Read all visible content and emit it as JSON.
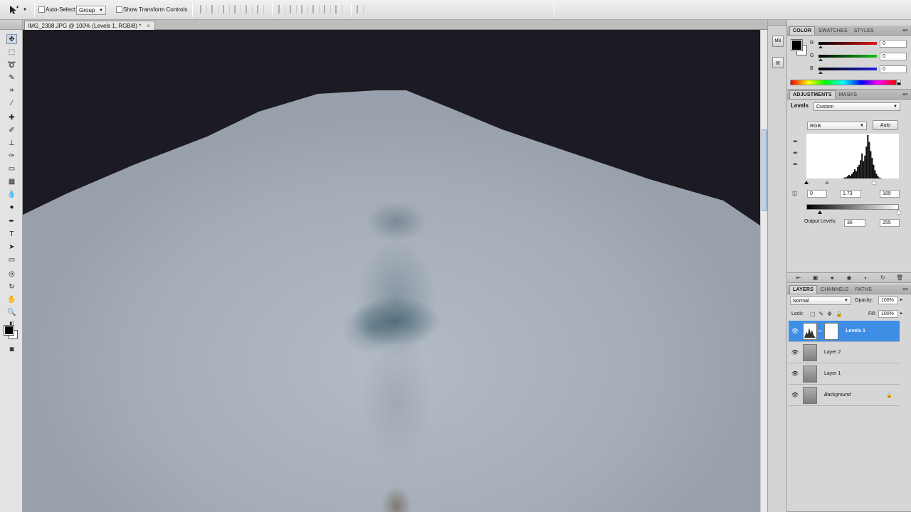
{
  "options_bar": {
    "auto_select_label": "Auto-Select:",
    "auto_select_value": "Group",
    "transform_label": "Show Transform Controls"
  },
  "document": {
    "tab_title": "IMG_2308.JPG @ 100% (Levels 1, RGB/8) *",
    "close_glyph": "×"
  },
  "panels": {
    "color": {
      "tabs": [
        "COLOR",
        "SWATCHES",
        "STYLES"
      ],
      "channels": [
        {
          "label": "R",
          "value": "0",
          "color": "#e01818"
        },
        {
          "label": "G",
          "value": "0",
          "color": "#18c018"
        },
        {
          "label": "B",
          "value": "0",
          "color": "#2020e0"
        }
      ]
    },
    "adjustments": {
      "tabs": [
        "ADJUSTMENTS",
        "MASKS"
      ],
      "title": "Levels",
      "preset": "Custom",
      "channel": "RGB",
      "auto_label": "Auto",
      "input_levels": {
        "black": "0",
        "gamma": "1.73",
        "white": "189"
      },
      "output_label": "Output Levels:",
      "output_levels": {
        "black": "36",
        "white": "255"
      },
      "histogram": [
        0,
        0,
        0,
        0,
        0,
        0,
        0,
        0,
        0,
        0,
        0,
        0,
        0,
        0,
        0,
        0,
        0,
        0,
        0,
        0,
        0,
        0,
        0,
        0,
        0,
        1,
        2,
        3,
        5,
        8,
        6,
        10,
        14,
        20,
        16,
        25,
        30,
        40,
        55,
        38,
        50,
        70,
        95,
        80,
        60,
        45,
        30,
        18,
        10,
        5,
        2,
        1,
        0,
        0,
        0,
        0,
        0,
        0,
        0,
        0,
        0,
        0,
        0,
        0
      ]
    },
    "layers": {
      "tabs": [
        "LAYERS",
        "CHANNELS",
        "PATHS"
      ],
      "blend_mode": "Normal",
      "opacity_label": "Opacity:",
      "opacity_value": "100%",
      "lock_label": "Lock:",
      "fill_label": "Fill:",
      "fill_value": "100%",
      "items": [
        {
          "name": "Levels 1",
          "selected": true,
          "adjustment": true
        },
        {
          "name": "Layer 2",
          "selected": false
        },
        {
          "name": "Layer 1",
          "selected": false
        },
        {
          "name": "Background",
          "selected": false,
          "locked": true
        }
      ]
    }
  },
  "colors": {
    "selection": "#3e8ee6",
    "panel_bg": "#d6d6d6"
  }
}
